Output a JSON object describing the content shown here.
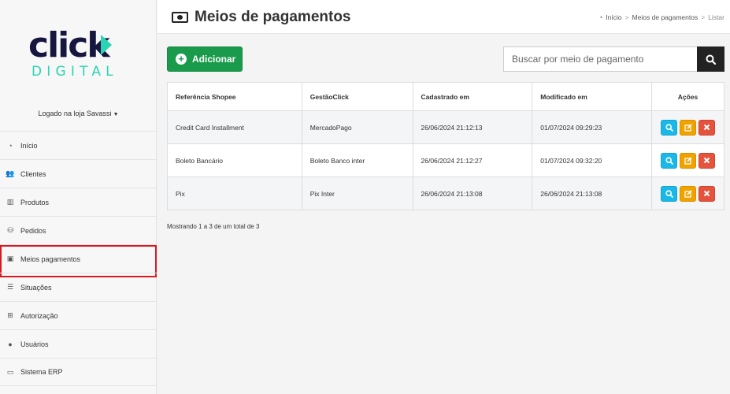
{
  "brand": {
    "logo_word": "click",
    "logo_sub": "DIGITAL",
    "accent_color": "#2bd4b4",
    "dark_color": "#16163f"
  },
  "sidebar": {
    "store_label": "Logado na loja Savassi",
    "items": [
      {
        "label": "Início",
        "icon": "dashboard-icon"
      },
      {
        "label": "Clientes",
        "icon": "users-icon"
      },
      {
        "label": "Produtos",
        "icon": "barcode-icon"
      },
      {
        "label": "Pedidos",
        "icon": "basket-icon"
      },
      {
        "label": "Meios pagamentos",
        "icon": "money-icon",
        "active": true
      },
      {
        "label": "Situações",
        "icon": "list-icon"
      },
      {
        "label": "Autorização",
        "icon": "sitemap-icon"
      },
      {
        "label": "Usuários",
        "icon": "user-icon"
      },
      {
        "label": "Sistema ERP",
        "icon": "laptop-icon"
      }
    ]
  },
  "header": {
    "title": "Meios de pagamentos",
    "breadcrumb": [
      "Início",
      "Meios de pagamentos",
      "Listar"
    ]
  },
  "toolbar": {
    "add_label": "Adicionar",
    "search_placeholder": "Buscar por meio de pagamento"
  },
  "table": {
    "columns": [
      "Referência Shopee",
      "GestãoClick",
      "Cadastrado em",
      "Modificado em",
      "Ações"
    ],
    "rows": [
      [
        "Credit Card Installment",
        "MercadoPago",
        "26/06/2024 21:12:13",
        "01/07/2024 09:29:23"
      ],
      [
        "Boleto Bancário",
        "Boleto Banco inter",
        "26/06/2024 21:12:27",
        "01/07/2024 09:32:20"
      ],
      [
        "Pix",
        "Pix Inter",
        "26/06/2024 21:13:08",
        "26/06/2024 21:13:08"
      ]
    ]
  },
  "summary": "Mostrando 1 a 3 de um total de 3"
}
